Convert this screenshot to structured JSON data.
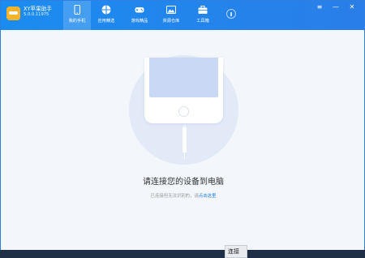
{
  "app": {
    "name": "XY苹果助手",
    "version": "5.0.0.11975"
  },
  "nav": [
    {
      "label": "我的手机",
      "icon": "phone-icon",
      "active": true
    },
    {
      "label": "应用精选",
      "icon": "apps-icon",
      "active": false
    },
    {
      "label": "游戏精品",
      "icon": "gamepad-icon",
      "active": false
    },
    {
      "label": "资源仓库",
      "icon": "image-icon",
      "active": false
    },
    {
      "label": "工具箱",
      "icon": "toolbox-icon",
      "active": false
    }
  ],
  "window_controls": {
    "menu": "≡",
    "minimize": "—",
    "close": "✕"
  },
  "main": {
    "prompt_title": "请连接您的设备到电脑",
    "prompt_sub_prefix": "已连接但无法识别的，请",
    "prompt_sub_link": "点击这里"
  },
  "taskbar": {
    "button_text": "连接"
  },
  "colors": {
    "accent": "#1a8cf0",
    "link": "#1a7fe8",
    "background": "#f3f6fb"
  }
}
